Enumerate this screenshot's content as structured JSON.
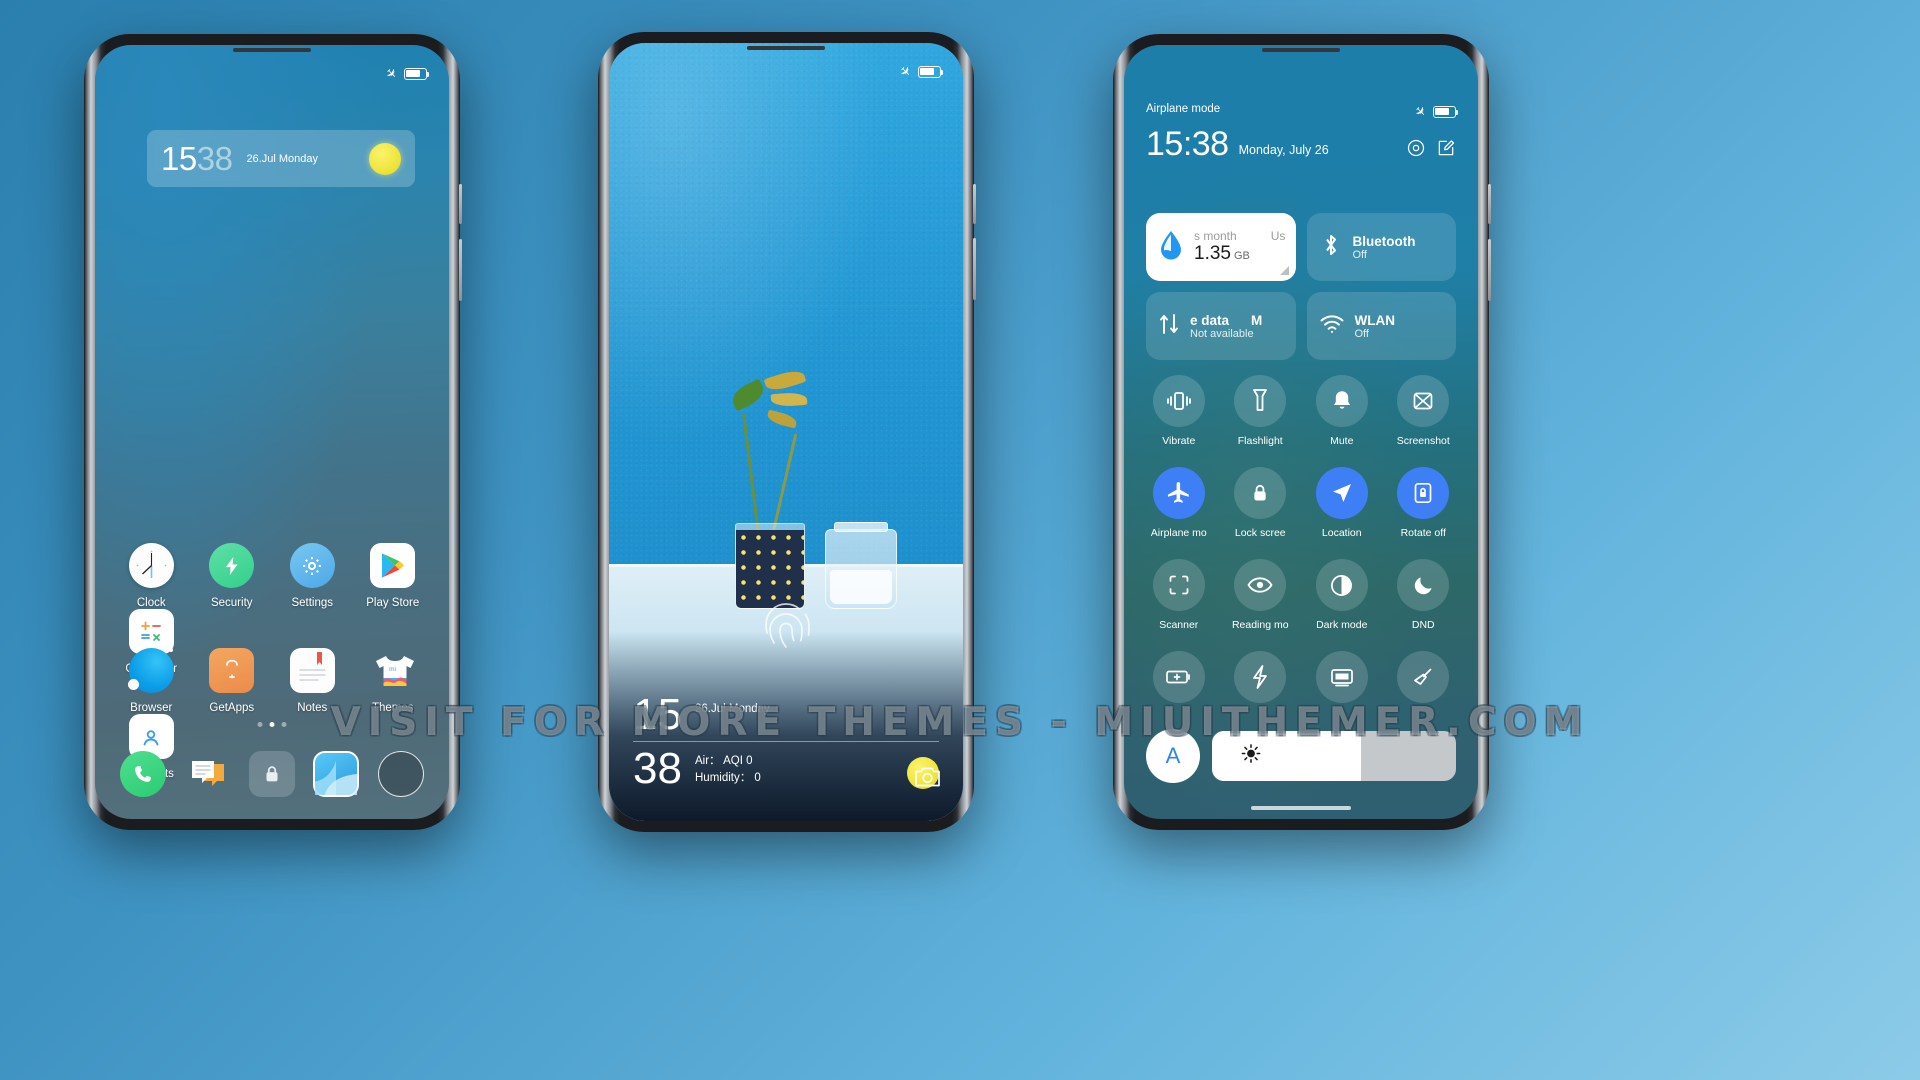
{
  "watermark": "VISIT  FOR  MORE  THEMES  -  MIUITHEMER.COM",
  "colors": {
    "accent_blue": "#3f7ff5",
    "brand_cyan": "#2ba3dd",
    "sun_yellow": "#ece236",
    "tile_light": "#ffffff"
  },
  "phone1": {
    "name": "Home screen",
    "status": {
      "airplane_icon": "airplane-icon",
      "battery_icon": "battery-icon"
    },
    "clock_widget": {
      "hour": "15",
      "minute": "38",
      "date": "26.Jul Monday",
      "weather_icon": "sun-icon"
    },
    "apps_row1": [
      {
        "label": "Clock",
        "icon": "clock-icon"
      },
      {
        "label": "Security",
        "icon": "shield-bolt-icon"
      },
      {
        "label": "Settings",
        "icon": "gear-icon"
      },
      {
        "label": "Play Store",
        "icon": "play-store-icon"
      },
      {
        "label": "Calculator",
        "icon": "calculator-icon"
      }
    ],
    "apps_row2": [
      {
        "label": "Browser",
        "icon": "browser-icon"
      },
      {
        "label": "GetApps",
        "icon": "shopping-bag-icon"
      },
      {
        "label": "Notes",
        "icon": "notes-icon"
      },
      {
        "label": "Themes",
        "icon": "tshirt-icon"
      },
      {
        "label": "Contacts",
        "icon": "contacts-icon"
      }
    ],
    "dock": [
      {
        "name": "phone",
        "icon": "phone-icon"
      },
      {
        "name": "messages",
        "icon": "message-icon"
      },
      {
        "name": "lock",
        "icon": "lock-icon"
      },
      {
        "name": "gallery",
        "icon": "gallery-icon"
      },
      {
        "name": "menu",
        "icon": "circle-icon"
      }
    ],
    "page_dots": 3,
    "active_dot": 1
  },
  "phone2": {
    "name": "Lock screen",
    "status": {
      "airplane_icon": "airplane-icon",
      "battery_icon": "battery-icon"
    },
    "lock_clock": {
      "hour": "15",
      "minute": "38",
      "date": "26.Jul Monday",
      "air": "Air： AQI 0",
      "humidity": "Humidity： 0",
      "weather_icon": "sun-icon"
    },
    "fingerprint_icon": "fingerprint-icon",
    "camera_icon": "camera-icon"
  },
  "phone3": {
    "name": "Control center",
    "status_label": "Airplane mode",
    "status": {
      "airplane_icon": "airplane-icon",
      "battery_icon": "battery-icon"
    },
    "time": "15:38",
    "date": "Monday, July 26",
    "header_icons": [
      {
        "name": "settings-icon"
      },
      {
        "name": "edit-icon"
      }
    ],
    "tiles": [
      {
        "id": "data-usage",
        "state": "light",
        "icon": "water-drop-icon",
        "top_left": "s month",
        "top_right": "Us",
        "value": "1.35",
        "unit": "GB"
      },
      {
        "id": "bluetooth",
        "state": "dim",
        "icon": "bluetooth-icon",
        "title": "Bluetooth",
        "sub": "Off"
      },
      {
        "id": "mobile-data",
        "state": "dim",
        "icon": "data-transfer-icon",
        "title": "e data",
        "title_right": "M",
        "sub": "Not available"
      },
      {
        "id": "wlan",
        "state": "dim",
        "icon": "wifi-icon",
        "title": "WLAN",
        "sub": "Off"
      }
    ],
    "toggles": [
      {
        "label": "Vibrate",
        "icon": "vibrate-icon",
        "on": false
      },
      {
        "label": "Flashlight",
        "icon": "flashlight-icon",
        "on": false
      },
      {
        "label": "Mute",
        "icon": "bell-mute-icon",
        "on": false
      },
      {
        "label": "Screenshot",
        "icon": "screenshot-icon",
        "on": false
      },
      {
        "label": "Airplane mo",
        "icon": "airplane-icon",
        "on": true
      },
      {
        "label": "Lock scree",
        "icon": "lock-icon",
        "on": false
      },
      {
        "label": "Location",
        "icon": "location-arrow-icon",
        "on": true
      },
      {
        "label": "Rotate off",
        "icon": "rotate-lock-icon",
        "on": true
      },
      {
        "label": "Scanner",
        "icon": "scan-frame-icon",
        "on": false
      },
      {
        "label": "Reading mo",
        "icon": "eye-icon",
        "on": false
      },
      {
        "label": "Dark mode",
        "icon": "contrast-icon",
        "on": false
      },
      {
        "label": "DND",
        "icon": "moon-icon",
        "on": false
      },
      {
        "label": "",
        "icon": "battery-plus-icon",
        "on": false
      },
      {
        "label": "",
        "icon": "bolt-icon",
        "on": false
      },
      {
        "label": "",
        "icon": "cast-screen-icon",
        "on": false
      },
      {
        "label": "",
        "icon": "broom-icon",
        "on": false
      }
    ],
    "brightness": {
      "auto_label": "A",
      "slider_icon": "brightness-icon",
      "fill_percent": 61
    }
  }
}
